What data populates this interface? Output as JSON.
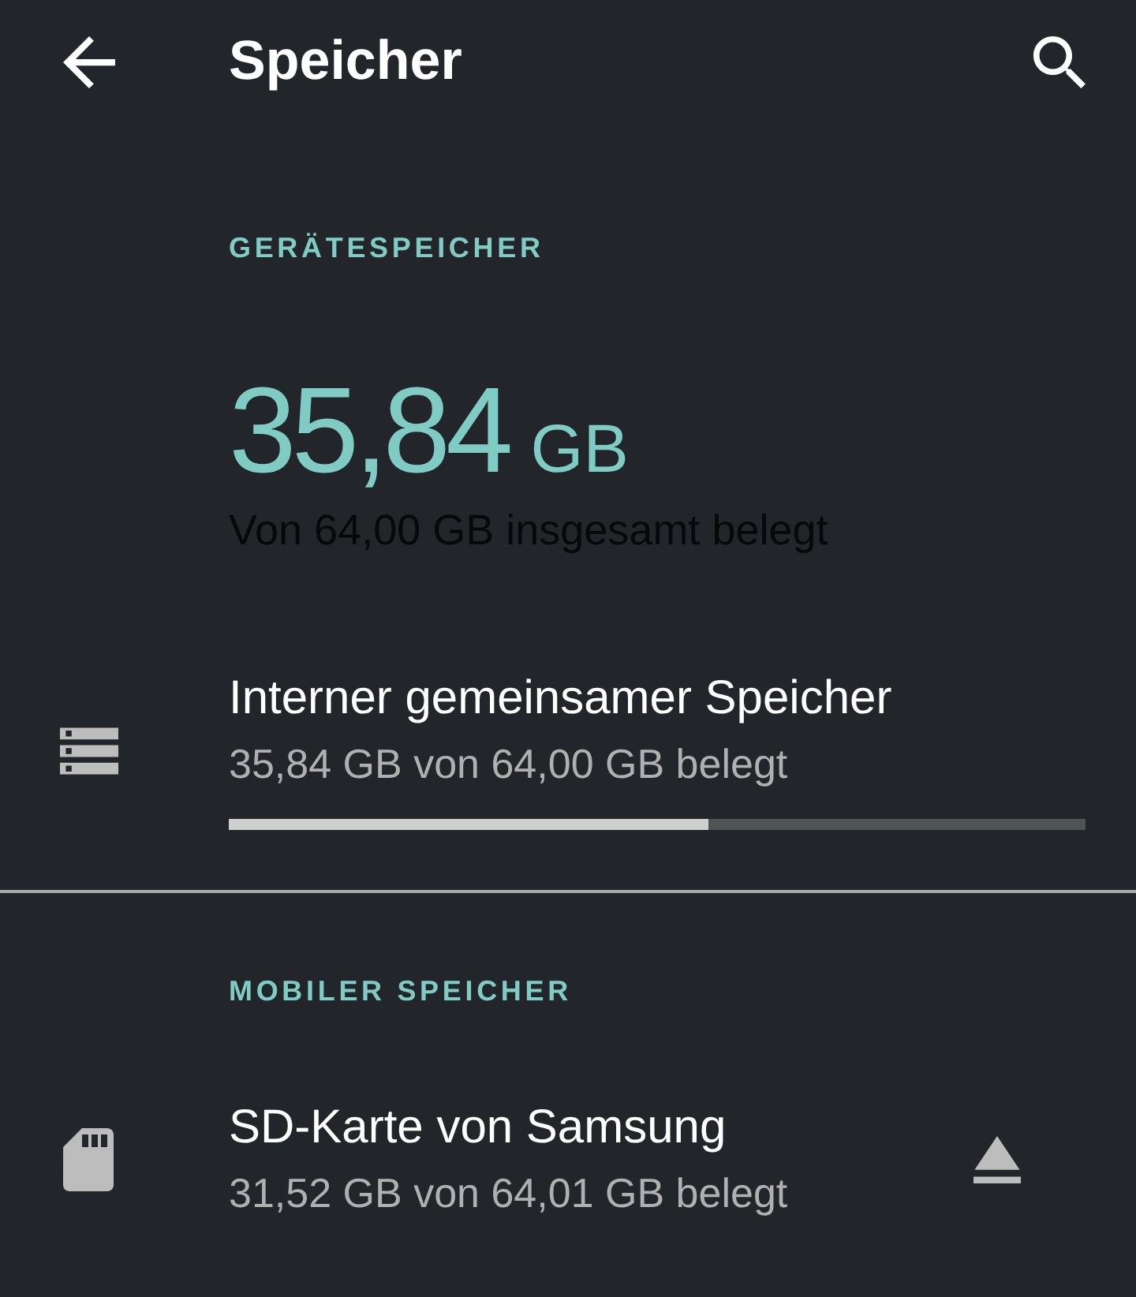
{
  "app_bar": {
    "title": "Speicher"
  },
  "device_storage": {
    "header": "GERÄTESPEICHER",
    "used_amount": "35,84",
    "used_unit": "GB",
    "summary": "Von 64,00 GB insgesamt belegt",
    "items": [
      {
        "kind": "internal",
        "title": "Interner gemeinsamer Speicher",
        "subtitle": "35,84 GB von 64,00 GB belegt",
        "level": 0.56
      }
    ]
  },
  "portable_storage": {
    "header": "MOBILER SPEICHER",
    "items": [
      {
        "kind": "sd_card",
        "title": "SD-Karte von Samsung",
        "subtitle": "31,52 GB von 64,01 GB belegt",
        "ejectable": true
      }
    ]
  }
}
